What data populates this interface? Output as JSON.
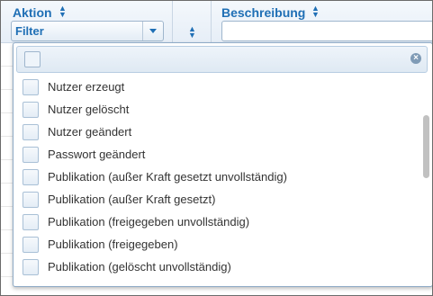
{
  "header": {
    "aktion_label": "Aktion",
    "filter_value": "Filter",
    "beschreibung_label": "Beschreibung",
    "beschreibung_value": ""
  },
  "dropdown": {
    "items": [
      {
        "label": "Nutzer erzeugt"
      },
      {
        "label": "Nutzer gelöscht"
      },
      {
        "label": "Nutzer geändert"
      },
      {
        "label": "Passwort geändert"
      },
      {
        "label": "Publikation (außer Kraft gesetzt unvollständig)"
      },
      {
        "label": "Publikation (außer Kraft gesetzt)"
      },
      {
        "label": "Publikation (freigegeben unvollständig)"
      },
      {
        "label": "Publikation (freigegeben)"
      },
      {
        "label": "Publikation (gelöscht unvollständig)"
      }
    ]
  },
  "colors": {
    "accent": "#1f6fb5",
    "header_bg": "#e6eef7",
    "border": "#8eaac6"
  },
  "icons": {
    "sort": "sort-updown-icon",
    "dropdown_arrow": "chevron-down-icon",
    "clear": "clear-x-icon"
  }
}
